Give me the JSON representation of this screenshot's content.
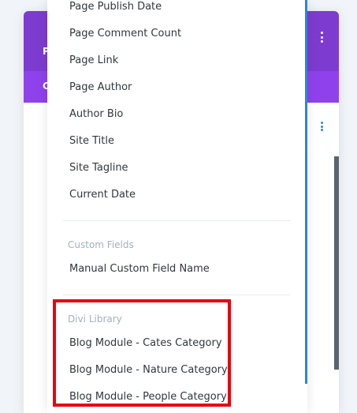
{
  "builder_panel": {
    "header_letter": "P",
    "tab_letter": "C"
  },
  "dropdown": {
    "items": [
      "Page Publish Date",
      "Page Comment Count",
      "Page Link",
      "Page Author",
      "Author Bio",
      "Site Title",
      "Site Tagline",
      "Current Date"
    ],
    "custom_fields": {
      "title": "Custom Fields",
      "items": [
        "Manual Custom Field Name"
      ]
    },
    "divi_library": {
      "title": "Divi Library",
      "items": [
        "Blog Module - Cates Category",
        "Blog Module - Nature Category",
        "Blog Module - People Category"
      ]
    }
  },
  "colors": {
    "header_purple": "#7e3bd0",
    "tabs_purple": "#8f42ec",
    "accent_blue": "#2b87da",
    "highlight_red": "#e8000f"
  }
}
